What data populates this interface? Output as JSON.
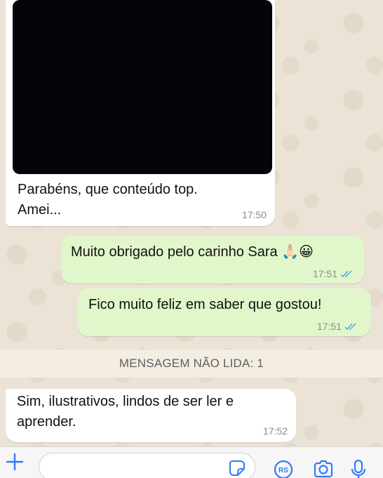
{
  "messages": [
    {
      "id": "b1",
      "direction": "incoming",
      "has_media": true,
      "text": "Parabéns, que conteúdo top.\nAmei...",
      "time": "17:50"
    },
    {
      "id": "b2",
      "direction": "outgoing",
      "text": "Muito obrigado pelo carinho Sara 🙏🏻😀",
      "time": "17:51",
      "ticks": "read"
    },
    {
      "id": "b3",
      "direction": "outgoing",
      "text": "Fico muito feliz em saber que gostou!",
      "time": "17:51",
      "ticks": "read"
    },
    {
      "id": "b4",
      "direction": "incoming",
      "text": "Sim, ilustrativos, lindos de ser ler e\naprender.",
      "time": "17:52"
    }
  ],
  "unread_banner": "MENSAGEM NÃO LIDA: 1",
  "composer": {
    "icons": [
      "plus-icon",
      "sticker-icon",
      "rs-icon",
      "camera-icon",
      "microphone-icon"
    ]
  },
  "colors": {
    "incoming_bubble": "#ffffff",
    "outgoing_bubble": "#e1f7cb",
    "accent": "#2f7cf6",
    "read_ticks": "#4fa7e8"
  }
}
